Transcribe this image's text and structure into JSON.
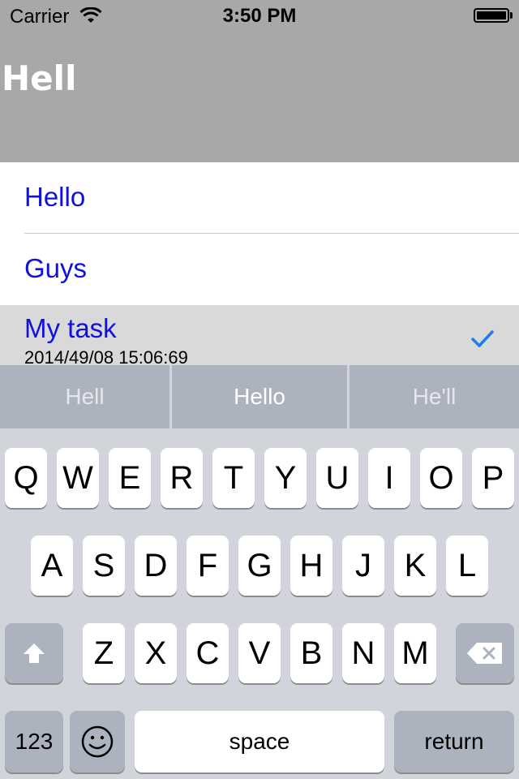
{
  "status_bar": {
    "carrier": "Carrier",
    "time": "3:50 PM"
  },
  "nav": {
    "title": "Hell"
  },
  "list": {
    "items": [
      {
        "label": "Hello"
      },
      {
        "label": "Guys"
      },
      {
        "label": "My task",
        "subtitle": "2014/49/08 15:06:69",
        "checked": true
      }
    ]
  },
  "suggestions": [
    "Hell",
    "Hello",
    "He'll"
  ],
  "keyboard": {
    "row1": [
      "Q",
      "W",
      "E",
      "R",
      "T",
      "Y",
      "U",
      "I",
      "O",
      "P"
    ],
    "row2": [
      "A",
      "S",
      "D",
      "F",
      "G",
      "H",
      "J",
      "K",
      "L"
    ],
    "row3": [
      "Z",
      "X",
      "C",
      "V",
      "B",
      "N",
      "M"
    ],
    "numbers_label": "123",
    "space_label": "space",
    "return_label": "return"
  },
  "colors": {
    "header_bg": "#a8a8a8",
    "list_text": "#1010e0",
    "check": "#1a7cf5",
    "keyboard_bg": "#d1d4da"
  },
  "icons": {
    "wifi": "wifi-icon",
    "battery": "battery-icon",
    "check": "checkmark-icon",
    "shift": "shift-icon",
    "delete": "delete-icon",
    "emoji": "emoji-icon"
  }
}
